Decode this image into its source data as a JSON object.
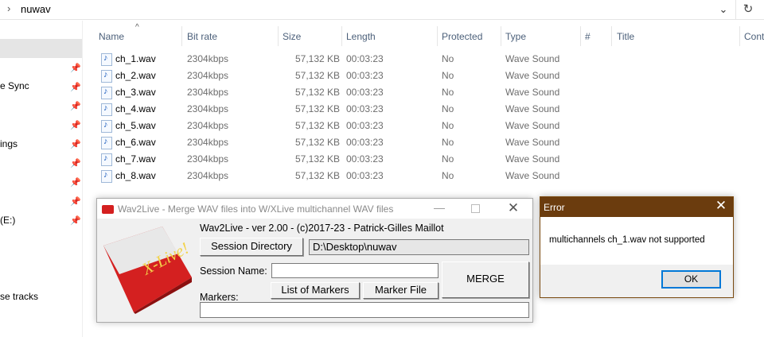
{
  "explorer": {
    "address": {
      "chevron": "›",
      "path": "nuwav",
      "dropdown_icon": "chevron-down-icon",
      "refresh_icon": "refresh-icon"
    },
    "nav": {
      "items": [
        {
          "label": "",
          "selected": true
        },
        {
          "label": "e Sync"
        },
        {
          "label": "ings"
        },
        {
          "label": "(E:)"
        },
        {
          "label": "se tracks"
        }
      ]
    },
    "columns": [
      "Name",
      "Bit rate",
      "Size",
      "Length",
      "Protected",
      "Type",
      "#",
      "Title",
      "Cont"
    ],
    "sort_column": "Name",
    "files": [
      {
        "name": "ch_1.wav",
        "bitrate": "2304kbps",
        "size": "57,132 KB",
        "length": "00:03:23",
        "protected": "No",
        "type": "Wave Sound"
      },
      {
        "name": "ch_2.wav",
        "bitrate": "2304kbps",
        "size": "57,132 KB",
        "length": "00:03:23",
        "protected": "No",
        "type": "Wave Sound"
      },
      {
        "name": "ch_3.wav",
        "bitrate": "2304kbps",
        "size": "57,132 KB",
        "length": "00:03:23",
        "protected": "No",
        "type": "Wave Sound"
      },
      {
        "name": "ch_4.wav",
        "bitrate": "2304kbps",
        "size": "57,132 KB",
        "length": "00:03:23",
        "protected": "No",
        "type": "Wave Sound"
      },
      {
        "name": "ch_5.wav",
        "bitrate": "2304kbps",
        "size": "57,132 KB",
        "length": "00:03:23",
        "protected": "No",
        "type": "Wave Sound"
      },
      {
        "name": "ch_6.wav",
        "bitrate": "2304kbps",
        "size": "57,132 KB",
        "length": "00:03:23",
        "protected": "No",
        "type": "Wave Sound"
      },
      {
        "name": "ch_7.wav",
        "bitrate": "2304kbps",
        "size": "57,132 KB",
        "length": "00:03:23",
        "protected": "No",
        "type": "Wave Sound"
      },
      {
        "name": "ch_8.wav",
        "bitrate": "2304kbps",
        "size": "57,132 KB",
        "length": "00:03:23",
        "protected": "No",
        "type": "Wave Sound"
      }
    ]
  },
  "wav2live": {
    "title": "Wav2Live - Merge WAV files into W/XLive multichannel WAV files",
    "version": "Wav2Live - ver 2.00 - (c)2017-23 - Patrick-Gilles Maillot",
    "logo_text": "X-Live!",
    "session_directory_label": "Session Directory",
    "session_directory_value": "D:\\Desktop\\nuwav",
    "session_name_label": "Session Name:",
    "session_name_value": "",
    "list_markers_label": "List of Markers",
    "marker_file_label": "Marker File",
    "merge_label": "MERGE",
    "markers_label": "Markers:",
    "markers_value": ""
  },
  "error_dialog": {
    "title": "Error",
    "message": "multichannels ch_1.wav not supported",
    "ok_label": "OK",
    "titlebar_color": "#6b3c0e"
  },
  "colors": {
    "header_text": "#4c607a",
    "cell_text": "#6d6d6d",
    "logo_red": "#d42020",
    "logo_gold": "#f2d24a"
  }
}
